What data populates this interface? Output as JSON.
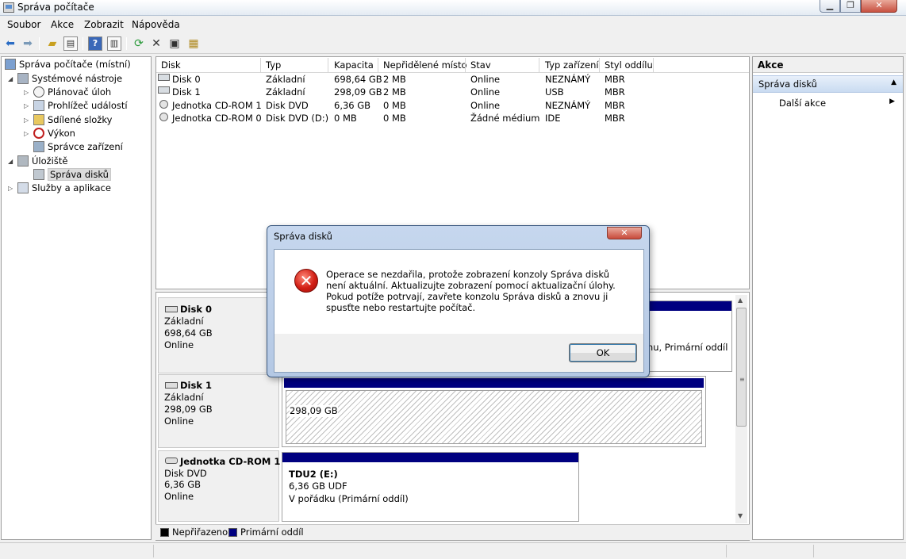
{
  "window": {
    "title": "Správa počítače",
    "controls": {
      "minimize": "▁",
      "maximize": "❐",
      "close": "✕"
    }
  },
  "menu": [
    "Soubor",
    "Akce",
    "Zobrazit",
    "Nápověda"
  ],
  "toolbar": {
    "icons": [
      "back-arrow-icon",
      "forward-arrow-icon",
      "up-folder-icon",
      "show-hide-tree-icon",
      "help-icon",
      "show-hide-action-pane-icon",
      "refresh-icon",
      "delete-icon",
      "properties-icon",
      "disk-wizard-icon"
    ]
  },
  "tree": {
    "root": "Správa počítače (místní)",
    "system_tools": "Systémové nástroje",
    "task_scheduler": "Plánovač úloh",
    "event_viewer": "Prohlížeč událostí",
    "shared_folders": "Sdílené složky",
    "performance": "Výkon",
    "device_manager": "Správce zařízení",
    "storage": "Úložiště",
    "disk_management": "Správa disků",
    "services_apps": "Služby a aplikace"
  },
  "volume_list": {
    "columns": [
      "Disk",
      "Typ",
      "Kapacita",
      "Nepřidělené místo",
      "Stav",
      "Typ zařízení",
      "Styl oddílu"
    ],
    "rows": [
      [
        "Disk 0",
        "Základní",
        "698,64 GB",
        "2 MB",
        "Online",
        "NEZNÁMÝ",
        "MBR"
      ],
      [
        "Disk 1",
        "Základní",
        "298,09 GB",
        "2 MB",
        "Online",
        "USB",
        "MBR"
      ],
      [
        "Jednotka CD-ROM 1",
        "Disk DVD",
        "6,36 GB",
        "0 MB",
        "Online",
        "NEZNÁMÝ",
        "MBR"
      ],
      [
        "Jednotka CD-ROM 0",
        "Disk DVD (D:)",
        "0 MB",
        "0 MB",
        "Žádné médium",
        "IDE",
        "MBR"
      ]
    ]
  },
  "disks": [
    {
      "name": "Disk 0",
      "type": "Základní",
      "size": "698,64 GB",
      "status": "Online",
      "partition_text": "mu, Primární oddíl"
    },
    {
      "name": "Disk 1",
      "type": "Základní",
      "size": "298,09 GB",
      "status": "Online",
      "partition_text": "298,09 GB"
    },
    {
      "name": "Jednotka CD-ROM 1",
      "type": "Disk DVD",
      "size": "6,36 GB",
      "status": "Online",
      "volume_name": "TDU2  (E:)",
      "volume_fs": "6,36 GB UDF",
      "volume_status": "V pořádku (Primární oddíl)"
    }
  ],
  "legend": {
    "unallocated": "Nepřiřazeno",
    "primary": "Primární oddíl",
    "unallocated_color": "#000000",
    "primary_color": "#000080"
  },
  "actions": {
    "header": "Akce",
    "section": "Správa disků",
    "more": "Další akce"
  },
  "dialog": {
    "title": "Správa disků",
    "close": "✕",
    "icon": "error-icon",
    "message": "Operace se nezdařila, protože zobrazení konzoly Správa disků není aktuální. Aktualizujte zobrazení pomocí aktualizační úlohy. Pokud potíže potrvají, zavřete konzolu Správa disků a znovu ji spusťte nebo restartujte počítač.",
    "ok": "OK"
  }
}
